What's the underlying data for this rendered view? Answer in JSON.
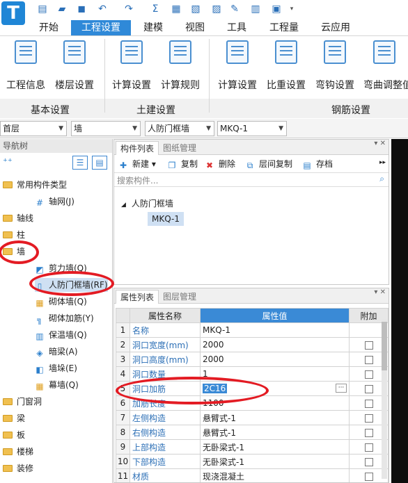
{
  "app": {
    "logo": "T"
  },
  "menu": {
    "tabs": [
      "开始",
      "工程设置",
      "建模",
      "视图",
      "工具",
      "工程量",
      "云应用"
    ],
    "active": "工程设置"
  },
  "ribbon": {
    "groups": [
      {
        "name": "基本设置",
        "buttons": [
          "工程信息",
          "楼层设置"
        ]
      },
      {
        "name": "土建设置",
        "buttons": [
          "计算设置",
          "计算规则"
        ]
      },
      {
        "name": "钢筋设置",
        "buttons": [
          "计算设置",
          "比重设置",
          "弯钩设置",
          "弯曲调整值"
        ]
      }
    ]
  },
  "combos": {
    "floor": "首层",
    "type": "墙",
    "subtype": "人防门框墙",
    "component": "MKQ-1"
  },
  "nav": {
    "title": "导航树",
    "items": [
      {
        "label": "常用构件类型",
        "level": 0
      },
      {
        "label": "轴网(J)",
        "level": 1
      },
      {
        "label": "轴线",
        "level": 0
      },
      {
        "label": "柱",
        "level": 0
      },
      {
        "label": "墙",
        "level": 0
      },
      {
        "label": "剪力墙(Q)",
        "level": 1
      },
      {
        "label": "人防门框墙(RF)",
        "level": 1
      },
      {
        "label": "砌体墙(Q)",
        "level": 1
      },
      {
        "label": "砌体加筋(Y)",
        "level": 1
      },
      {
        "label": "保温墙(Q)",
        "level": 1
      },
      {
        "label": "暗梁(A)",
        "level": 1
      },
      {
        "label": "墙垛(E)",
        "level": 1
      },
      {
        "label": "幕墙(Q)",
        "level": 1
      },
      {
        "label": "门窗洞",
        "level": 0
      },
      {
        "label": "梁",
        "level": 0
      },
      {
        "label": "板",
        "level": 0
      },
      {
        "label": "楼梯",
        "level": 0
      },
      {
        "label": "装修",
        "level": 0
      }
    ]
  },
  "component_panel": {
    "tabs": [
      "构件列表",
      "图纸管理"
    ],
    "toolbar": [
      "新建",
      "复制",
      "删除",
      "层间复制",
      "存档"
    ],
    "search_placeholder": "搜索构件...",
    "tree": {
      "parent": "人防门框墙",
      "child": "MKQ-1"
    }
  },
  "property_panel": {
    "tabs": [
      "属性列表",
      "图层管理"
    ],
    "headers": [
      "属性名称",
      "属性值",
      "附加"
    ],
    "rows": [
      {
        "num": "1",
        "name": "名称",
        "value": "MKQ-1"
      },
      {
        "num": "2",
        "name": "洞口宽度(mm)",
        "value": "2000"
      },
      {
        "num": "3",
        "name": "洞口高度(mm)",
        "value": "2000"
      },
      {
        "num": "4",
        "name": "洞口数量",
        "value": "1"
      },
      {
        "num": "5",
        "name": "洞口加筋",
        "value": "2C16"
      },
      {
        "num": "6",
        "name": "加筋长度",
        "value": "1100"
      },
      {
        "num": "7",
        "name": "左侧构造",
        "value": "悬臂式-1"
      },
      {
        "num": "8",
        "name": "右侧构造",
        "value": "悬臂式-1"
      },
      {
        "num": "9",
        "name": "上部构造",
        "value": "无卧梁式-1"
      },
      {
        "num": "10",
        "name": "下部构造",
        "value": "无卧梁式-1"
      },
      {
        "num": "11",
        "name": "材质",
        "value": "现浇混凝土"
      }
    ]
  },
  "colors": {
    "accent": "#2f89d8",
    "highlight": "#e31b23"
  }
}
